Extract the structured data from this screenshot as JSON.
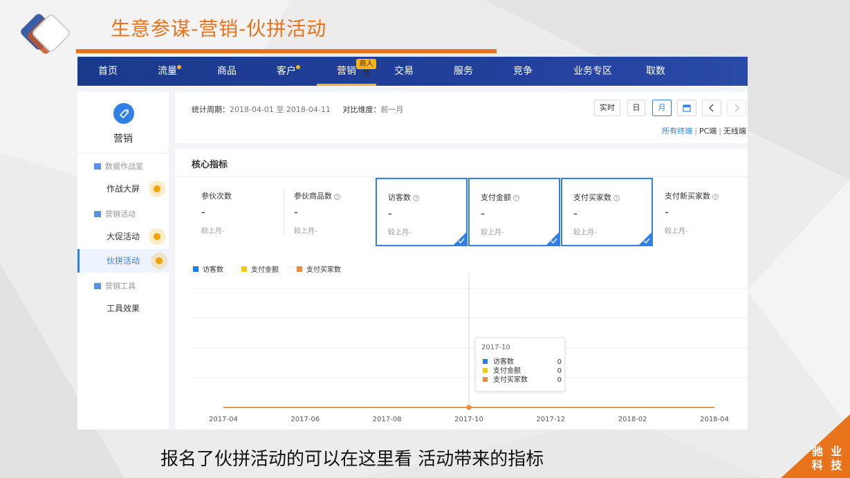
{
  "slide": {
    "title": "生意参谋-营销-伙拼活动",
    "caption": "报名了伙拼活动的可以在这里看 活动带来的指标",
    "brand_line1": "驰 业",
    "brand_line2": "科 技",
    "accent_color": "#e8731b"
  },
  "nav": {
    "items": [
      {
        "label": "首页"
      },
      {
        "label": "流量",
        "dot": true
      },
      {
        "label": "商品"
      },
      {
        "label": "客户",
        "dot": true
      },
      {
        "label": "营销",
        "active": true,
        "badge": "商人节"
      },
      {
        "label": "交易"
      },
      {
        "label": "服务"
      },
      {
        "label": "竞争"
      },
      {
        "label": "业务专区"
      },
      {
        "label": "取数"
      }
    ],
    "background": "#223f9a",
    "highlight": "#f6b419"
  },
  "sidebar": {
    "title": "营销",
    "icon": "tag-icon",
    "groups": [
      {
        "label": "数据作战室",
        "items": [
          {
            "label": "作战大屏",
            "pin": true
          }
        ]
      },
      {
        "label": "营销活动",
        "items": [
          {
            "label": "大促活动",
            "pin": true
          },
          {
            "label": "伙拼活动",
            "pin": true,
            "active": true
          }
        ]
      },
      {
        "label": "营销工具",
        "items": [
          {
            "label": "工具效果"
          }
        ]
      }
    ]
  },
  "filter": {
    "period_label": "统计周期：",
    "period_value": "2018-04-01 至 2018-04-11",
    "compare_label": "对比维度：",
    "compare_value": "前一月",
    "buttons": {
      "realtime": "实时",
      "day": "日",
      "month": "月"
    },
    "calendar_icon": "calendar-icon",
    "prev_icon": "chevron-left-icon",
    "next_icon": "chevron-right-icon",
    "device_tabs": [
      "所有终端",
      "PC端",
      "无线端"
    ],
    "device_separator": "|"
  },
  "core": {
    "title": "核心指标",
    "kpis": [
      {
        "name": "参伙次数",
        "value": "-",
        "compare": "较上月-",
        "help": false,
        "selected": false
      },
      {
        "name": "参伙商品数",
        "value": "-",
        "compare": "较上月-",
        "help": true,
        "selected": false
      },
      {
        "name": "访客数",
        "value": "-",
        "compare": "较上月-",
        "help": true,
        "selected": true
      },
      {
        "name": "支付金额",
        "value": "-",
        "compare": "较上月-",
        "help": true,
        "selected": true
      },
      {
        "name": "支付买家数",
        "value": "-",
        "compare": "较上月-",
        "help": true,
        "selected": true
      },
      {
        "name": "支付新买家数",
        "value": "-",
        "compare": "较上月-",
        "help": true,
        "selected": false
      }
    ],
    "help_mark": "?"
  },
  "chart_data": {
    "type": "line",
    "x": [
      "2017-04",
      "2017-05",
      "2017-06",
      "2017-07",
      "2017-08",
      "2017-09",
      "2017-10",
      "2017-11",
      "2017-12",
      "2018-01",
      "2018-02",
      "2018-03",
      "2018-04"
    ],
    "x_tick_labels": [
      "2017-04",
      "2017-06",
      "2017-08",
      "2017-10",
      "2017-12",
      "2018-02",
      "2018-04"
    ],
    "series": [
      {
        "name": "访客数",
        "color": "#1a7fe8",
        "values": [
          0,
          0,
          0,
          0,
          0,
          0,
          0,
          0,
          0,
          0,
          0,
          0,
          0
        ]
      },
      {
        "name": "支付金额",
        "color": "#f5c518",
        "values": [
          0,
          0,
          0,
          0,
          0,
          0,
          0,
          0,
          0,
          0,
          0,
          0,
          0
        ]
      },
      {
        "name": "支付买家数",
        "color": "#f08a3c",
        "values": [
          0,
          0,
          0,
          0,
          0,
          0,
          0,
          0,
          0,
          0,
          0,
          0,
          0
        ]
      }
    ],
    "grid": true,
    "legend": "top-left",
    "tooltip": {
      "title": "2017-10",
      "rows": [
        {
          "name": "访客数",
          "value": "0",
          "color": "#1a7fe8"
        },
        {
          "name": "支付金额",
          "value": "0",
          "color": "#f5c518"
        },
        {
          "name": "支付买家数",
          "value": "0",
          "color": "#f08a3c"
        }
      ]
    }
  }
}
